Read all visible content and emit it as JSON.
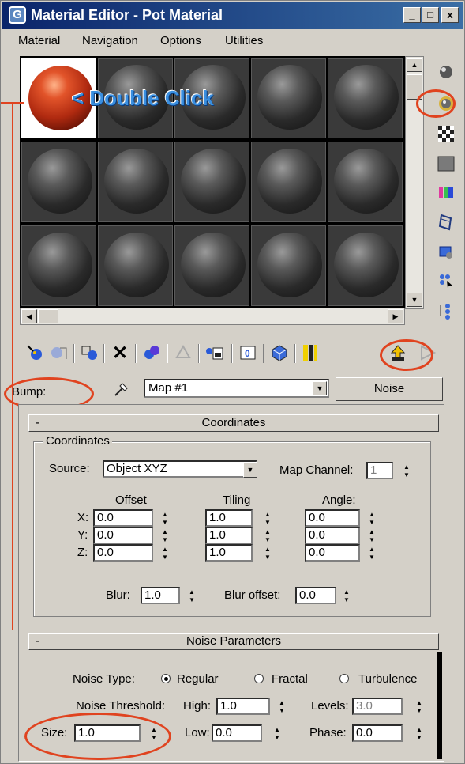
{
  "window": {
    "title": "Material Editor - Pot Material",
    "title_icon": "G",
    "controls": [
      "_",
      "□",
      "x"
    ]
  },
  "menu": [
    "Material",
    "Navigation",
    "Options",
    "Utilities"
  ],
  "callout": {
    "text": "< Double Click"
  },
  "sample_slots": {
    "rows": 3,
    "cols": 5,
    "active_slot": 0
  },
  "side_tools": [
    "sample-type-sphere-icon",
    "backlight-icon",
    "checker-background-icon",
    "sample-uv-tiling-icon",
    "video-color-check-icon",
    "make-preview-icon",
    "options-icon",
    "select-by-material-icon",
    "material-map-navigator-icon"
  ],
  "toolbar": [
    "get-material-icon",
    "put-to-scene-icon",
    "assign-to-selection-icon",
    "reset-map-icon",
    "make-unique-icon",
    "put-to-library-icon",
    "material-effects-channel-icon",
    "show-map-in-viewport-icon",
    "show-end-result-icon",
    "go-to-parent-icon",
    "go-forward-to-sibling-icon"
  ],
  "bump": {
    "label": "Bump:",
    "map_name": "Map #1",
    "type_button": "Noise"
  },
  "coordinates": {
    "rollout_title": "Coordinates",
    "group_title": "Coordinates",
    "source_label": "Source:",
    "source_value": "Object XYZ",
    "map_channel_label": "Map Channel:",
    "map_channel_value": "1",
    "col_offset": "Offset",
    "col_tiling": "Tiling",
    "col_angle": "Angle:",
    "rows": [
      {
        "axis": "X:",
        "offset": "0.0",
        "tiling": "1.0",
        "angle": "0.0"
      },
      {
        "axis": "Y:",
        "offset": "0.0",
        "tiling": "1.0",
        "angle": "0.0"
      },
      {
        "axis": "Z:",
        "offset": "0.0",
        "tiling": "1.0",
        "angle": "0.0"
      }
    ],
    "blur_label": "Blur:",
    "blur_value": "1.0",
    "blur_offset_label": "Blur offset:",
    "blur_offset_value": "0.0"
  },
  "noise": {
    "rollout_title": "Noise Parameters",
    "noise_type_label": "Noise Type:",
    "types": [
      "Regular",
      "Fractal",
      "Turbulence"
    ],
    "selected_type": "Regular",
    "threshold_label": "Noise Threshold:",
    "high_label": "High:",
    "high_value": "1.0",
    "levels_label": "Levels:",
    "levels_value": "3.0",
    "size_label": "Size:",
    "size_value": "1.0",
    "low_label": "Low:",
    "low_value": "0.0",
    "phase_label": "Phase:",
    "phase_value": "0.0"
  },
  "colors": {
    "highlight": "#e0431f",
    "callout_text": "#3a8fe0",
    "title_bar": "#0a246a"
  }
}
